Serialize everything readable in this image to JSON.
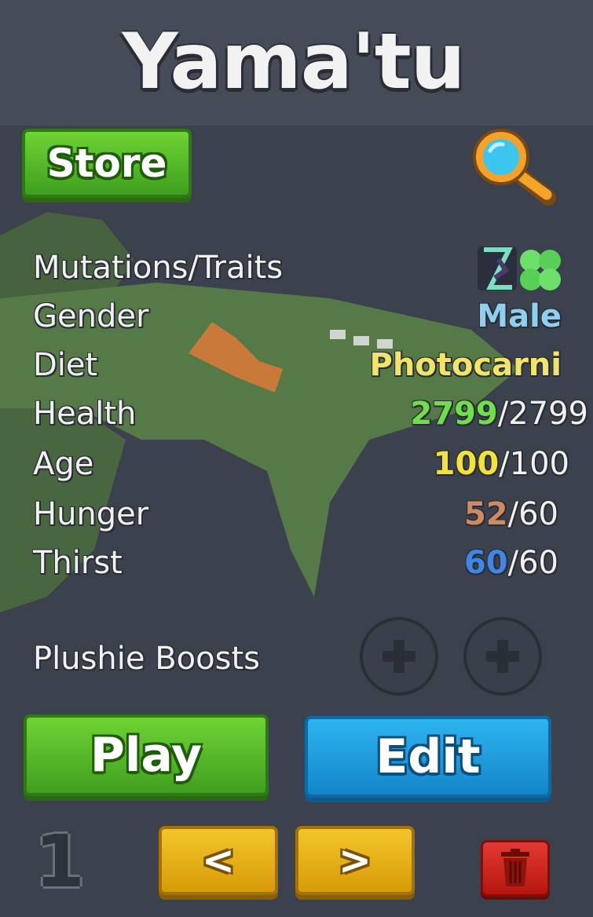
{
  "title": "Yama'tu",
  "store_button": {
    "label": "Store"
  },
  "search_icon": "magnifier-icon",
  "stats": {
    "mutations_label": "Mutations/Traits",
    "gender_label": "Gender",
    "gender_value": "Male",
    "diet_label": "Diet",
    "diet_value": "Photocarni",
    "health_label": "Health",
    "health_current": "2799",
    "health_max": "/2799",
    "age_label": "Age",
    "age_current": "100",
    "age_max": "/100",
    "hunger_label": "Hunger",
    "hunger_current": "52",
    "hunger_max": "/60",
    "thirst_label": "Thirst",
    "thirst_current": "60",
    "thirst_max": "/60"
  },
  "plushie": {
    "label": "Plushie Boosts",
    "slots": [
      "+",
      "+"
    ]
  },
  "play_button": {
    "label": "Play"
  },
  "edit_button": {
    "label": "Edit"
  },
  "slot_number": "1",
  "prev_button": {
    "label": "<"
  },
  "next_button": {
    "label": ">"
  },
  "colors": {
    "gender": "#8fcff0",
    "diet": "#f2e46a",
    "health": "#6fe04a",
    "age": "#f3e23a",
    "hunger": "#d08a62",
    "thirst": "#3f86e8",
    "panel": "#3e4550"
  }
}
